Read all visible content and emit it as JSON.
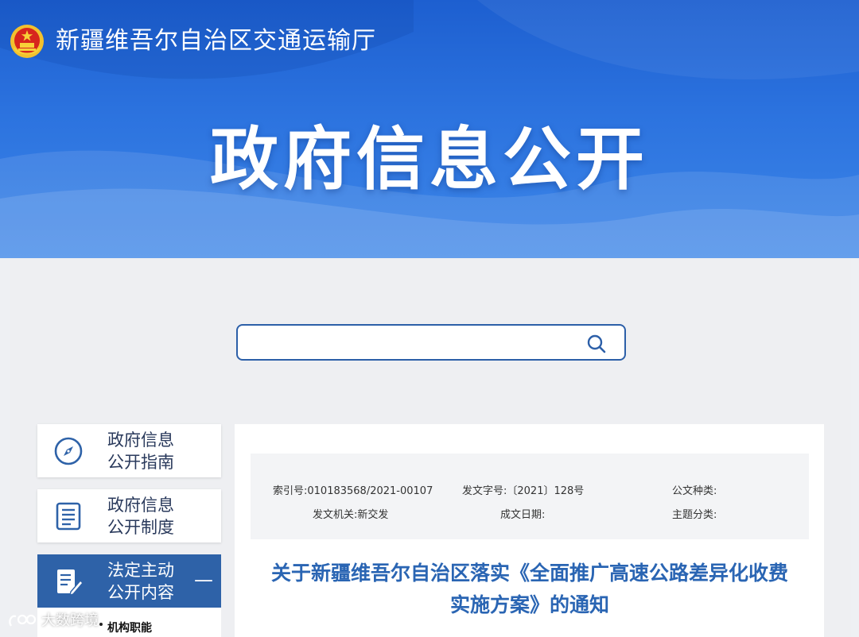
{
  "header": {
    "site_name": "新疆维吾尔自治区交通运输厅",
    "banner_title": "政府信息公开"
  },
  "search": {
    "placeholder": ""
  },
  "sidebar": {
    "items": [
      {
        "line1": "政府信息",
        "line2": "公开指南",
        "icon": "compass-icon",
        "active": false
      },
      {
        "line1": "政府信息",
        "line2": "公开制度",
        "icon": "document-list-icon",
        "active": false
      },
      {
        "line1": "法定主动",
        "line2": "公开内容",
        "icon": "document-edit-icon",
        "active": true,
        "toggle": "—"
      }
    ],
    "sub_items": [
      {
        "label": "机构职能"
      }
    ]
  },
  "document": {
    "meta": {
      "index_no_label": "索引号:",
      "index_no": "010183568/2021-00107",
      "doc_no_label": "发文字号:",
      "doc_no": "〔2021〕128号",
      "doc_type_label": "公文种类:",
      "doc_type": "",
      "issuer_label": "发文机关:",
      "issuer": "新交发",
      "date_label": "成文日期:",
      "date": "",
      "topic_label": "主题分类:",
      "topic": ""
    },
    "title_line1": "关于新疆维吾尔自治区落实《全面推广高速公路差异化收费",
    "title_line2": "实施方案》的通知"
  },
  "watermark": {
    "text": "大数跨境"
  },
  "colors": {
    "header_blue": "#2c73df",
    "active_blue": "#2e62a8",
    "title_blue": "#2a65b3"
  }
}
